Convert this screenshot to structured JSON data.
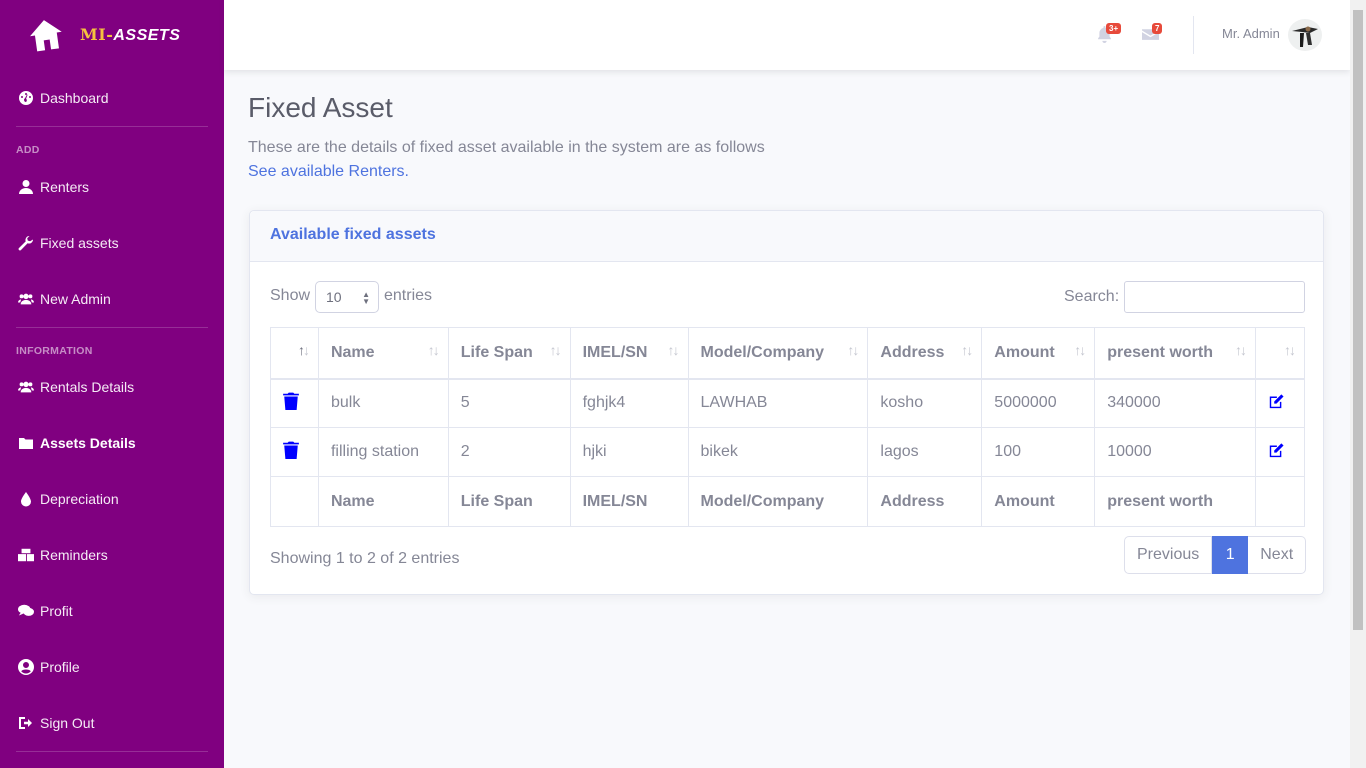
{
  "brand": {
    "mi": "MI-",
    "assets": "ASSETS"
  },
  "sidebar": {
    "items": [
      {
        "label": "Dashboard",
        "icon": "tachometer-icon"
      },
      {
        "label": "Renters",
        "icon": "user-icon"
      },
      {
        "label": "Fixed assets",
        "icon": "wrench-icon"
      },
      {
        "label": "New Admin",
        "icon": "users-icon"
      },
      {
        "label": "Rentals Details",
        "icon": "users-icon"
      },
      {
        "label": "Assets Details",
        "icon": "folder-icon"
      },
      {
        "label": "Depreciation",
        "icon": "tint-icon"
      },
      {
        "label": "Reminders",
        "icon": "mail-bulk-icon"
      },
      {
        "label": "Profit",
        "icon": "comments-icon"
      },
      {
        "label": "Profile",
        "icon": "user-circle-icon"
      },
      {
        "label": "Sign Out",
        "icon": "sign-out-icon"
      }
    ],
    "heading_add": "ADD",
    "heading_info": "INFORMATION"
  },
  "topbar": {
    "alerts_badge": "3+",
    "messages_badge": "7",
    "user_name": "Mr. Admin"
  },
  "main": {
    "title": "Fixed Asset",
    "description": "These are the details of fixed asset available in the system are as follows",
    "link": "See available Renters."
  },
  "card": {
    "title": "Available fixed assets",
    "show_label": "Show",
    "show_value": "10",
    "entries_label": "entries",
    "search_label": "Search:",
    "columns": [
      "",
      "Name",
      "Life Span",
      "IMEL/SN",
      "Model/Company",
      "Address",
      "Amount",
      "present worth",
      ""
    ],
    "rows": [
      {
        "name": "bulk",
        "life_span": "5",
        "imel": "fghjk4",
        "model": "LAWHAB",
        "address": "kosho",
        "amount": "5000000",
        "worth": "340000"
      },
      {
        "name": "filling station",
        "life_span": "2",
        "imel": "hjki",
        "model": "bikek",
        "address": "lagos",
        "amount": "100",
        "worth": "10000"
      }
    ],
    "info": "Showing 1 to 2 of 2 entries",
    "pager": {
      "prev": "Previous",
      "current": "1",
      "next": "Next"
    }
  },
  "colors": {
    "sidebar": "#800080",
    "primary": "#4e73df",
    "action_icon": "#0000ff"
  }
}
